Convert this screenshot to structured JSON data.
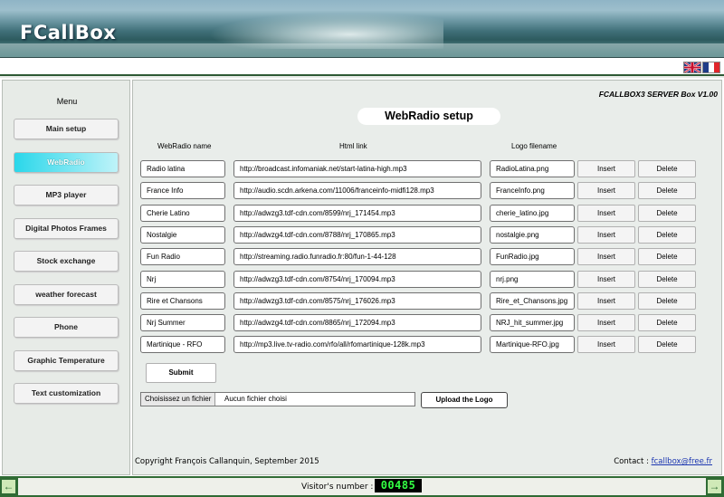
{
  "header": {
    "logo": "FCallBox"
  },
  "languages": [
    "english-flag",
    "french-flag"
  ],
  "sidebar": {
    "title": "Menu",
    "items": [
      {
        "label": "Main setup",
        "active": false
      },
      {
        "label": "WebRadio",
        "active": true
      },
      {
        "label": "MP3 player",
        "active": false
      },
      {
        "label": "Digital Photos Frames",
        "active": false
      },
      {
        "label": "Stock exchange",
        "active": false
      },
      {
        "label": "weather forecast",
        "active": false
      },
      {
        "label": "Phone",
        "active": false
      },
      {
        "label": "Graphic Temperature",
        "active": false
      },
      {
        "label": "Text customization",
        "active": false
      }
    ]
  },
  "main": {
    "version": "FCALLBOX3 SERVER Box V1.00",
    "title": "WebRadio setup",
    "columns": {
      "name": "WebRadio name",
      "link": "Html link",
      "logo": "Logo filename"
    },
    "insert_label": "Insert",
    "delete_label": "Delete",
    "rows": [
      {
        "name": "Radio latina",
        "link": "http://broadcast.infomaniak.net/start-latina-high.mp3",
        "logo": "RadioLatina.png"
      },
      {
        "name": "France Info",
        "link": "http://audio.scdn.arkena.com/11006/franceinfo-midfi128.mp3",
        "logo": "FranceInfo.png"
      },
      {
        "name": "Cherie Latino",
        "link": "http://adwzg3.tdf-cdn.com/8599/nrj_171454.mp3",
        "logo": "cherie_latino.jpg"
      },
      {
        "name": "Nostalgie",
        "link": "http://adwzg4.tdf-cdn.com/8788/nrj_170865.mp3",
        "logo": "nostalgie.png"
      },
      {
        "name": "Fun Radio",
        "link": "http://streaming.radio.funradio.fr:80/fun-1-44-128",
        "logo": "FunRadio.jpg"
      },
      {
        "name": "Nrj",
        "link": "http://adwzg3.tdf-cdn.com/8754/nrj_170094.mp3",
        "logo": "nrj.png"
      },
      {
        "name": "Rire et Chansons",
        "link": "http://adwzg3.tdf-cdn.com/8575/nrj_176026.mp3",
        "logo": "Rire_et_Chansons.jpg"
      },
      {
        "name": "Nrj Summer",
        "link": "http://adwzg4.tdf-cdn.com/8865/nrj_172094.mp3",
        "logo": "NRJ_hit_summer.jpg"
      },
      {
        "name": "Martinique - RFO",
        "link": "http://mp3.live.tv-radio.com/rfo/all/rfomartinique-128k.mp3",
        "logo": "Martinique-RFO.jpg"
      }
    ],
    "submit_label": "Submit",
    "file_button": "Choisissez un fichier",
    "file_status": "Aucun fichier choisi",
    "upload_label": "Upload the Logo",
    "copyright": "Copyright François Callanquin, September 2015",
    "contact_label": "Contact :",
    "contact_email": "fcallbox@free.fr"
  },
  "footer": {
    "visitor_label": "Visitor's number :",
    "visitor_count": "00485",
    "left_arrow": "←",
    "right_arrow": "→"
  }
}
